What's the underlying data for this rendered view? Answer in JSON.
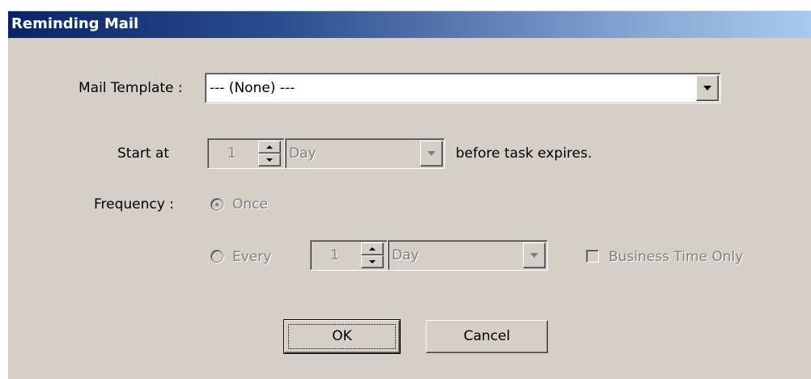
{
  "window": {
    "title": "Reminding Mail"
  },
  "mail_template": {
    "label": "Mail Template :",
    "selected": "--- (None) ---"
  },
  "start_at": {
    "label": "Start at",
    "value": "1",
    "unit": "Day",
    "suffix": "before task expires."
  },
  "frequency": {
    "label": "Frequency :",
    "once_label": "Once",
    "once_selected": true,
    "every_label": "Every",
    "every_selected": false,
    "every_value": "1",
    "every_unit": "Day",
    "business_time_label": "Business Time Only",
    "business_time_checked": false
  },
  "buttons": {
    "ok": "OK",
    "cancel": "Cancel"
  },
  "colors": {
    "dialog_bg": "#d4d0c8",
    "title_start": "#0a246a",
    "title_end": "#a6caf0",
    "disabled_text": "#808080"
  }
}
